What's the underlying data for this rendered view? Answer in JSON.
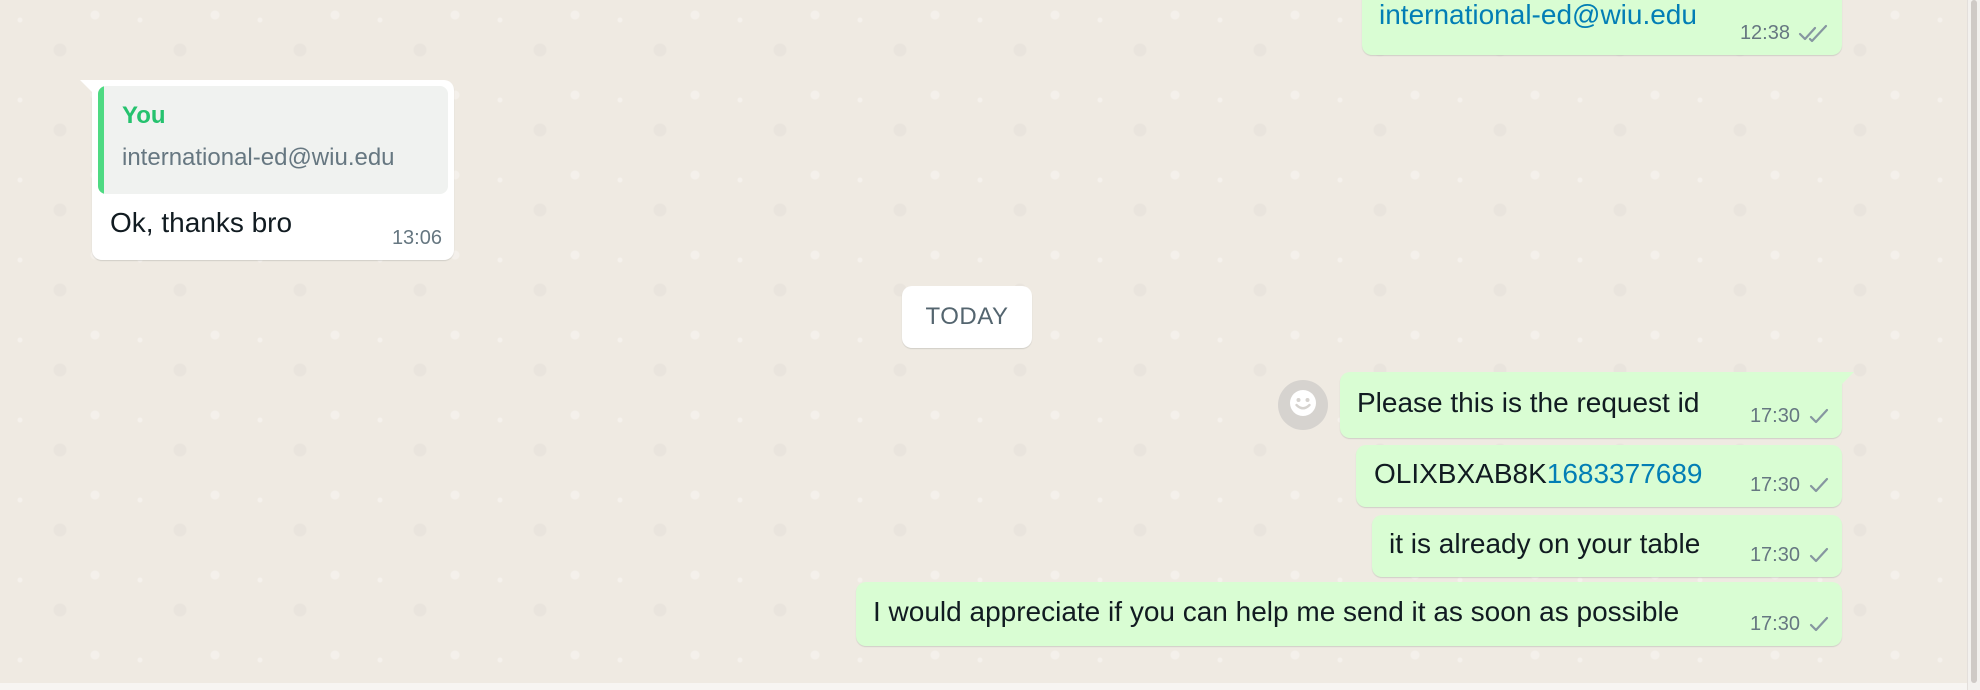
{
  "messages": {
    "top": {
      "text": "international-ed@wiu.edu",
      "time": "12:38",
      "status_icon": "double-check-icon"
    },
    "reply": {
      "quote_author": "You",
      "quote_text": "international-ed@wiu.edu",
      "text": "Ok, thanks bro",
      "time": "13:06"
    },
    "date_separator": "TODAY",
    "outgoing": [
      {
        "text": "Please this is the request id",
        "time": "17:30",
        "status_icon": "check-icon"
      },
      {
        "text_prefix": "OLIXBXAB8K",
        "text_link": "1683377689",
        "time": "17:30",
        "status_icon": "check-icon"
      },
      {
        "text": "it is already on your table",
        "time": "17:30",
        "status_icon": "check-icon"
      },
      {
        "text": "I would appreciate if you can help me send it as soon as possible",
        "time": "17:30",
        "status_icon": "check-icon"
      }
    ]
  },
  "colors": {
    "outgoing_bubble": "#d9fdd3",
    "incoming_bubble": "#ffffff",
    "link": "#027eb5",
    "quote_author": "#25c26e",
    "wallpaper": "#efeae2"
  },
  "icons": {
    "emoji_button": "smiley-icon"
  }
}
